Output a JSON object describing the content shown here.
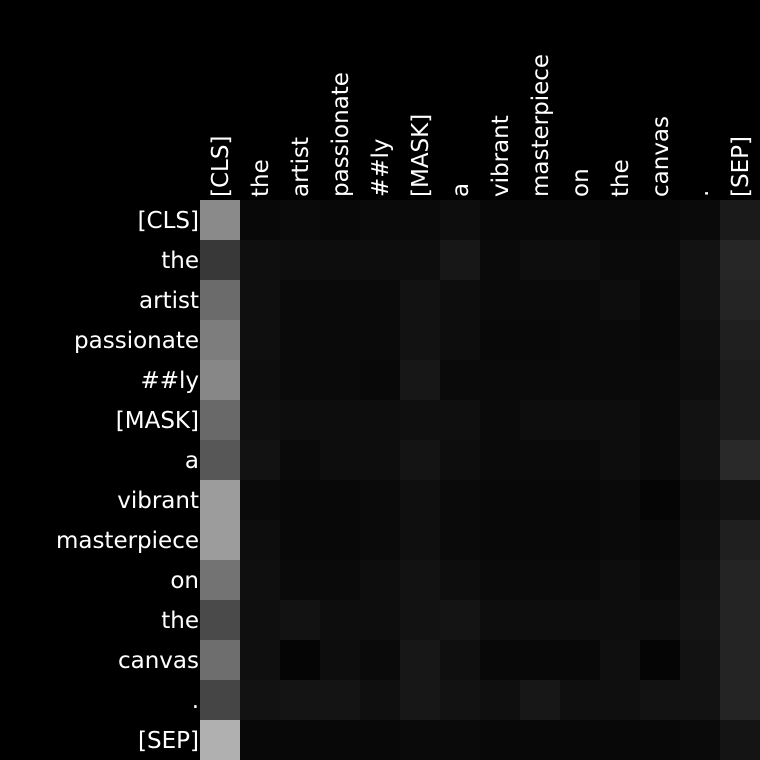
{
  "chart_data": {
    "type": "heatmap",
    "title": "",
    "xlabel": "",
    "ylabel": "",
    "x_tokens": [
      "[CLS]",
      "the",
      "artist",
      "passionate",
      "##ly",
      "[MASK]",
      "a",
      "vibrant",
      "masterpiece",
      "on",
      "the",
      "canvas",
      ".",
      "[SEP]"
    ],
    "y_tokens": [
      "[CLS]",
      "the",
      "artist",
      "passionate",
      "##ly",
      "[MASK]",
      "a",
      "vibrant",
      "masterpiece",
      "on",
      "the",
      "canvas",
      ".",
      "[SEP]"
    ],
    "value_range": [
      0,
      1
    ],
    "colormap": "grayscale",
    "values": [
      [
        0.54,
        0.03,
        0.04,
        0.03,
        0.04,
        0.04,
        0.05,
        0.03,
        0.03,
        0.03,
        0.03,
        0.03,
        0.04,
        0.1
      ],
      [
        0.22,
        0.06,
        0.05,
        0.05,
        0.05,
        0.05,
        0.09,
        0.04,
        0.05,
        0.05,
        0.04,
        0.04,
        0.07,
        0.15
      ],
      [
        0.42,
        0.06,
        0.04,
        0.04,
        0.04,
        0.07,
        0.05,
        0.04,
        0.04,
        0.04,
        0.05,
        0.03,
        0.07,
        0.14
      ],
      [
        0.49,
        0.06,
        0.04,
        0.04,
        0.04,
        0.07,
        0.05,
        0.03,
        0.03,
        0.04,
        0.04,
        0.03,
        0.06,
        0.12
      ],
      [
        0.53,
        0.05,
        0.04,
        0.04,
        0.03,
        0.09,
        0.04,
        0.04,
        0.04,
        0.04,
        0.04,
        0.04,
        0.05,
        0.11
      ],
      [
        0.41,
        0.06,
        0.05,
        0.05,
        0.05,
        0.06,
        0.06,
        0.04,
        0.05,
        0.05,
        0.05,
        0.04,
        0.07,
        0.11
      ],
      [
        0.34,
        0.07,
        0.04,
        0.05,
        0.05,
        0.08,
        0.05,
        0.04,
        0.04,
        0.04,
        0.05,
        0.04,
        0.07,
        0.16
      ],
      [
        0.61,
        0.04,
        0.03,
        0.03,
        0.04,
        0.06,
        0.04,
        0.03,
        0.03,
        0.03,
        0.04,
        0.02,
        0.05,
        0.07
      ],
      [
        0.61,
        0.05,
        0.03,
        0.03,
        0.04,
        0.06,
        0.04,
        0.03,
        0.03,
        0.03,
        0.04,
        0.03,
        0.06,
        0.12
      ],
      [
        0.45,
        0.06,
        0.04,
        0.04,
        0.05,
        0.07,
        0.05,
        0.04,
        0.04,
        0.04,
        0.05,
        0.04,
        0.07,
        0.14
      ],
      [
        0.29,
        0.06,
        0.07,
        0.05,
        0.05,
        0.07,
        0.08,
        0.05,
        0.05,
        0.05,
        0.05,
        0.05,
        0.08,
        0.14
      ],
      [
        0.43,
        0.06,
        0.02,
        0.05,
        0.04,
        0.09,
        0.06,
        0.03,
        0.03,
        0.03,
        0.06,
        0.02,
        0.07,
        0.14
      ],
      [
        0.27,
        0.07,
        0.08,
        0.08,
        0.06,
        0.09,
        0.07,
        0.06,
        0.09,
        0.06,
        0.06,
        0.07,
        0.07,
        0.14
      ],
      [
        0.69,
        0.03,
        0.03,
        0.03,
        0.03,
        0.04,
        0.04,
        0.03,
        0.03,
        0.03,
        0.03,
        0.03,
        0.04,
        0.08
      ]
    ]
  }
}
